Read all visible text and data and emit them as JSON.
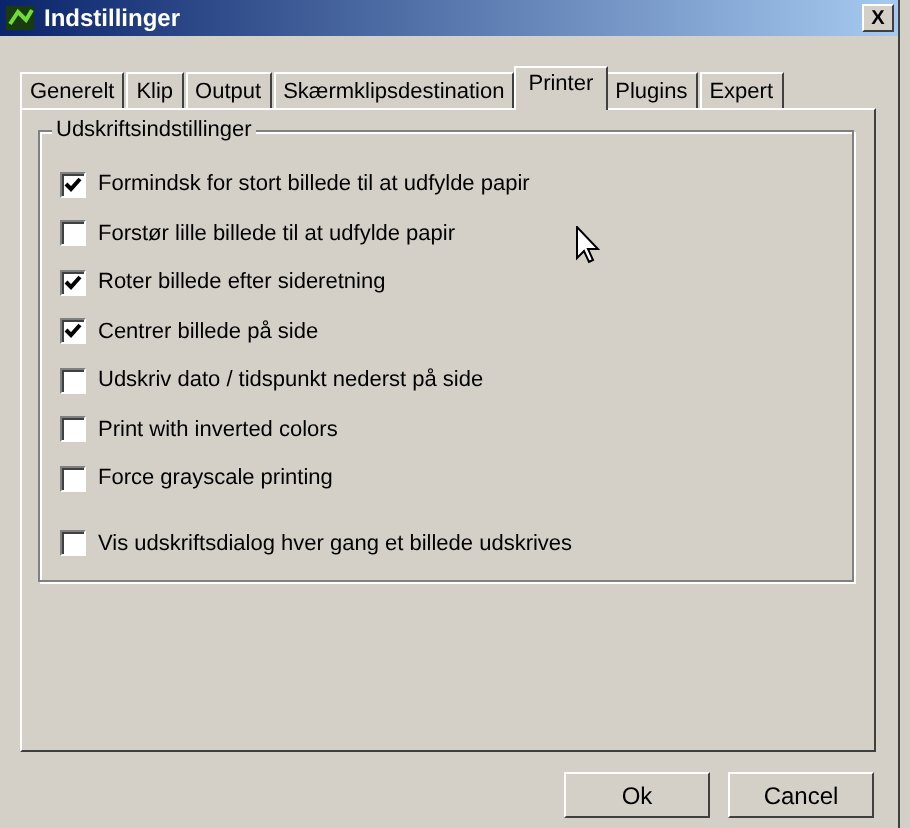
{
  "window": {
    "title": "Indstillinger",
    "close": "X"
  },
  "tabs": [
    {
      "label": "Generelt",
      "selected": false
    },
    {
      "label": "Klip",
      "selected": false
    },
    {
      "label": "Output",
      "selected": false
    },
    {
      "label": "Skærmklipsdestination",
      "selected": false
    },
    {
      "label": "Printer",
      "selected": true
    },
    {
      "label": "Plugins",
      "selected": false
    },
    {
      "label": "Expert",
      "selected": false
    }
  ],
  "group": {
    "title": "Udskriftsindstillinger",
    "options": [
      {
        "label": "Formindsk for stort billede til at udfylde papir",
        "checked": true
      },
      {
        "label": "Forstør lille billede til at udfylde papir",
        "checked": false
      },
      {
        "label": "Roter billede efter sideretning",
        "checked": true
      },
      {
        "label": "Centrer billede på side",
        "checked": true
      },
      {
        "label": "Udskriv dato / tidspunkt nederst på side",
        "checked": false
      },
      {
        "label": "Print with inverted colors",
        "checked": false
      },
      {
        "label": "Force grayscale printing",
        "checked": false
      }
    ],
    "dialog_option": {
      "label": "Vis udskriftsdialog hver gang et billede udskrives",
      "checked": false
    }
  },
  "buttons": [
    "Ok",
    "Cancel"
  ]
}
